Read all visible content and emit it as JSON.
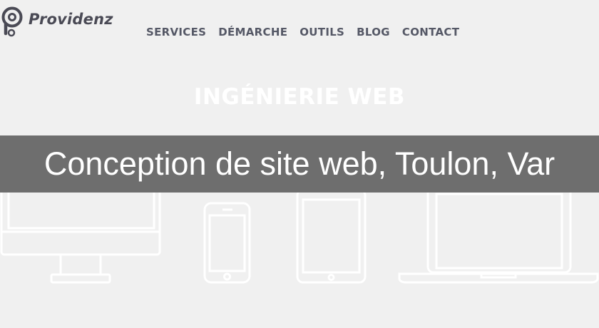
{
  "brand": {
    "name": "Providenz"
  },
  "nav": {
    "items": [
      {
        "label": "SERVICES"
      },
      {
        "label": "DÉMARCHE"
      },
      {
        "label": "OUTILS"
      },
      {
        "label": "BLOG"
      },
      {
        "label": "CONTACT"
      }
    ]
  },
  "hero": {
    "title": "INGÉNIERIE WEB"
  },
  "banner": {
    "text": "Conception de site web, Toulon, Var"
  },
  "icons": [
    "desktop-monitor-icon",
    "smartphone-icon",
    "tablet-icon",
    "laptop-icon"
  ],
  "colors": {
    "background": "#f0f0f0",
    "nav_text": "#555866",
    "logo_text": "#4a4a55",
    "banner_bg": "#696969",
    "banner_text": "#ffffff",
    "device_outline": "#ffffff"
  }
}
